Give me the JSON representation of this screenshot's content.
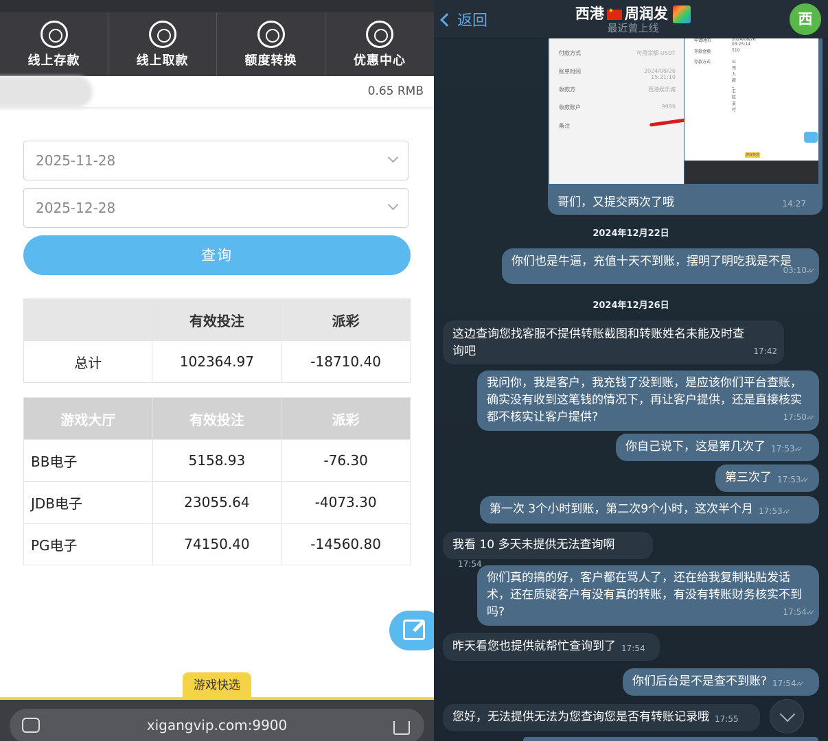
{
  "left": {
    "nav": [
      {
        "label": "线上存款",
        "icon": "deposit-icon"
      },
      {
        "label": "线上取款",
        "icon": "withdraw-icon"
      },
      {
        "label": "额度转换",
        "icon": "transfer-icon"
      },
      {
        "label": "优惠中心",
        "icon": "promo-icon"
      }
    ],
    "balance": "0.65 RMB",
    "start_date": "2025-11-28",
    "end_date": "2025-12-28",
    "query_label": "查询",
    "summary": {
      "headers": [
        "",
        "有效投注",
        "派彩"
      ],
      "row": {
        "label": "总计",
        "bet": "102364.97",
        "payout": "-18710.40"
      }
    },
    "halls": {
      "headers": [
        "游戏大厅",
        "有效投注",
        "派彩"
      ],
      "rows": [
        {
          "name": "BB电子",
          "bet": "5158.93",
          "payout": "-76.30"
        },
        {
          "name": "JDB电子",
          "bet": "23055.64",
          "payout": "-4073.30"
        },
        {
          "name": "PG电子",
          "bet": "74150.40",
          "payout": "-14560.80"
        }
      ]
    },
    "game_quick_label": "游戏快选",
    "url": "xigangvip.com:9900",
    "colors": {
      "accent": "#5ab9ef",
      "nav_bg": "#3a3a3f",
      "highlight": "#f5d347"
    }
  },
  "right": {
    "back_label": "返回",
    "title_part1": "西港",
    "title_part2": "周润发",
    "subtitle": "最近曾上线",
    "avatar_letter": "西",
    "shot": {
      "left_rows": [
        {
          "label": "付款方式",
          "value": "可用余额-USDT"
        },
        {
          "label": "账单时间",
          "value": "2024/08/26 15:21:10"
        },
        {
          "label": "收款方",
          "value": "西港娱乐城"
        },
        {
          "label": "收款账户",
          "value": "9999"
        },
        {
          "label": "备注",
          "value": ""
        }
      ],
      "right_rows": [
        {
          "label": "申请时间",
          "value": "2024/08/26 03:25:14"
        },
        {
          "label": "存款金额",
          "value": "510"
        },
        {
          "label": "存款方式",
          "value": "公司入款_汇旺支付"
        }
      ],
      "tag": "游戏快选"
    },
    "img_caption": "哥们，又提交两次了哦",
    "img_time": "14:27",
    "date1": "2024年12月22日",
    "date2": "2024年12月26日",
    "messages": [
      {
        "text": "你们也是牛逼，充值十天不到账，摆明了明吃我是不是",
        "time": "03:10"
      },
      {
        "text": "这边查询您找客服不提供转账截图和转账姓名未能及时查询吧",
        "time": "17:42"
      },
      {
        "text": "我问你，我是客户，我充钱了没到账，是应该你们平台查账，确实没有收到这笔钱的情况下，再让客户提供，还是直接核实都不核实让客户提供?",
        "time": "17:50"
      },
      {
        "text": "你自己说下，这是第几次了",
        "time": "17:53"
      },
      {
        "text": "第三次了",
        "time": "17:53"
      },
      {
        "text": "第一次 3个小时到账，第二次9个小时，这次半个月",
        "time": "17:53"
      },
      {
        "text": "我看 10 多天未提供无法查询啊",
        "time": "17:54"
      },
      {
        "text": "你们真的搞的好，客户都在骂人了，还在给我复制粘贴发话术，还在质疑客户有没有真的转账，有没有转账财务核实不到吗?",
        "time": "17:54"
      },
      {
        "text": "昨天看您也提供就帮忙查询到了",
        "time": "17:54"
      },
      {
        "text": "你们后台是不是查不到账?",
        "time": "17:54"
      },
      {
        "text": "您好，无法提供无法为您查询您是否有转账记录哦",
        "time": "17:55"
      }
    ],
    "colors": {
      "out_bubble": "#4a6a86",
      "in_bubble": "#2a3641",
      "link": "#5fa8e8",
      "avatar": "#59b84a"
    }
  }
}
